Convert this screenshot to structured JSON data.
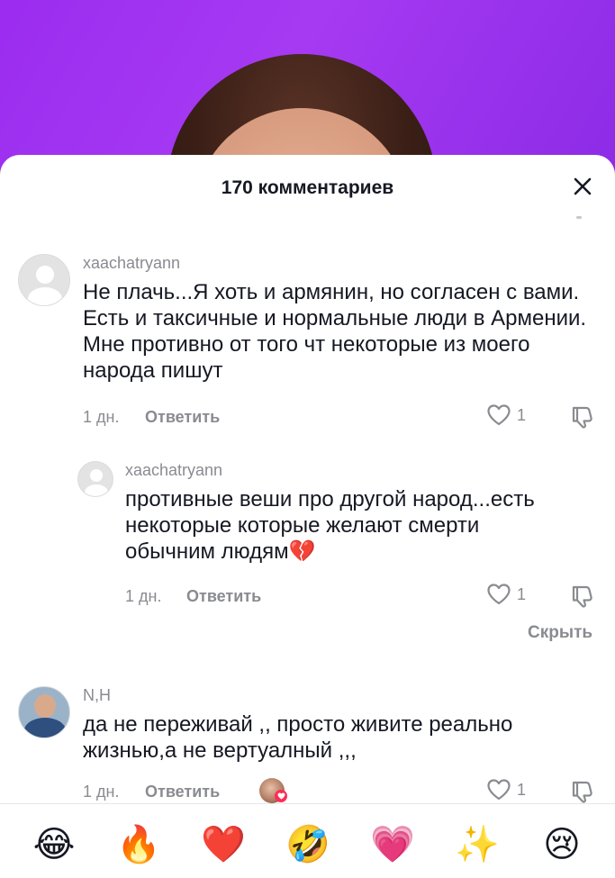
{
  "header": {
    "title": "170 комментариев"
  },
  "comments": [
    {
      "username": "xaachatryann",
      "text": "Не плачь...Я хоть и армянин, но согласен с вами. Есть и таксичные и нормальные люди в Армении. Мне противно от того чт некоторые из моего народа пишут",
      "age": "1 дн.",
      "reply_label": "Ответить",
      "likes": "1"
    },
    {
      "username": "xaachatryann",
      "text": "противные веши про другой народ...есть некоторые которые желают смерти обычним людям💔",
      "age": "1 дн.",
      "reply_label": "Ответить",
      "likes": "1"
    },
    {
      "username": "N,H",
      "text": "да не переживай ,, просто живите реально жизнью,а не вертуалный ,,,",
      "age": "1 дн.",
      "reply_label": "Ответить",
      "likes": "1"
    }
  ],
  "hide_replies_label": "Скрыть",
  "emoji_bar": [
    "😂",
    "🔥",
    "❤️",
    "🤣",
    "💗",
    "✨",
    "😢"
  ],
  "icons": {
    "close": "close-icon",
    "like": "heart-outline-icon",
    "dislike": "thumbs-down-icon",
    "creator_liked": "creator-liked-badge"
  },
  "colors": {
    "video_bg": "#9b2cf0",
    "text_primary": "#161823",
    "text_secondary": "#8a8b91",
    "accent": "#fe2c55"
  }
}
